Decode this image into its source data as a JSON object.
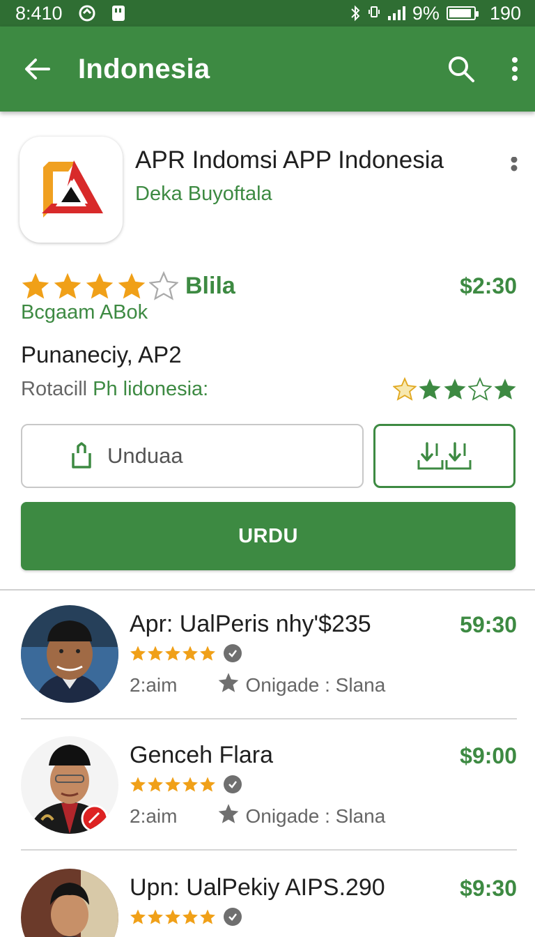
{
  "status_bar": {
    "time": "8:410",
    "battery_text": "9%",
    "extra": "190",
    "battery_level": 0.9
  },
  "app_bar": {
    "title": "Indonesia"
  },
  "app": {
    "name": "APR Indomsi APP Indonesia",
    "developer": "Deka Buyoftala",
    "rating_stars": 4,
    "rating_label": "Blila",
    "price": "$2:30",
    "category": "Bcgaam ABok",
    "subtitle": "Punaneciy, AP2",
    "desc_part1": "Rotacill ",
    "desc_part2": "Ph lidonesia:"
  },
  "buttons": {
    "outline_label": "Unduaa",
    "primary_label": "URDU"
  },
  "list": [
    {
      "title": "Apr: UalPeris nhy'$235",
      "price": "59:30",
      "meta_left": "2:aim",
      "meta_right": "Onigade : Slana",
      "stars": 5
    },
    {
      "title": "Genceh Flara",
      "price": "$9:00",
      "meta_left": "2:aim",
      "meta_right": "Onigade : Slana",
      "stars": 5
    },
    {
      "title": "Upn: UalPekiy AIPS.290",
      "price": "$9:30",
      "meta_left": "",
      "meta_right": "",
      "stars": 5
    }
  ],
  "colors": {
    "accent": "#3d8a42",
    "status_bar": "#2f6e33",
    "star": "#f0a018"
  }
}
